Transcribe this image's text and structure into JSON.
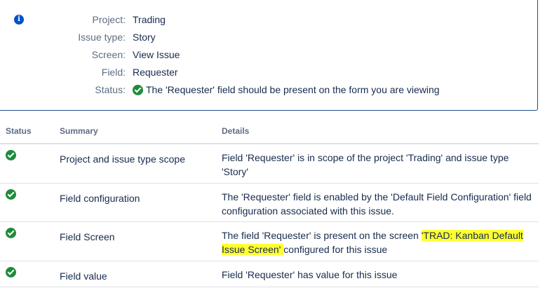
{
  "info": {
    "icon": "info-icon",
    "rows": [
      {
        "label": "Project:",
        "value": "Trading"
      },
      {
        "label": "Issue type:",
        "value": "Story"
      },
      {
        "label": "Screen:",
        "value": "View Issue"
      },
      {
        "label": "Field:",
        "value": "Requester"
      },
      {
        "label": "Status:",
        "value": "The 'Requester' field should be present on the form you are viewing"
      }
    ]
  },
  "table": {
    "headers": {
      "status": "Status",
      "summary": "Summary",
      "details": "Details"
    },
    "rows": [
      {
        "status": "check-icon",
        "summary": "Project and issue type scope",
        "details": "Field 'Requester' is in scope of the project 'Trading' and issue type 'Story'"
      },
      {
        "status": "check-icon",
        "summary": "Field configuration",
        "details": "The 'Requester' field is enabled by the 'Default Field Configuration' field configuration associated with this issue."
      },
      {
        "status": "check-icon",
        "summary": "Field Screen",
        "details_before": "The field 'Requester' is present on the screen ",
        "details_highlight": "'TRAD: Kanban Default Issue Screen' ",
        "details_after": "configured for this issue"
      },
      {
        "status": "check-icon",
        "summary": "Field value",
        "details": "Field 'Requester' has value for this issue"
      }
    ]
  },
  "colors": {
    "accent_border": "#1d4e89",
    "success": "#1f8b3a",
    "info": "#0052cc",
    "highlight": "#ffff33"
  }
}
